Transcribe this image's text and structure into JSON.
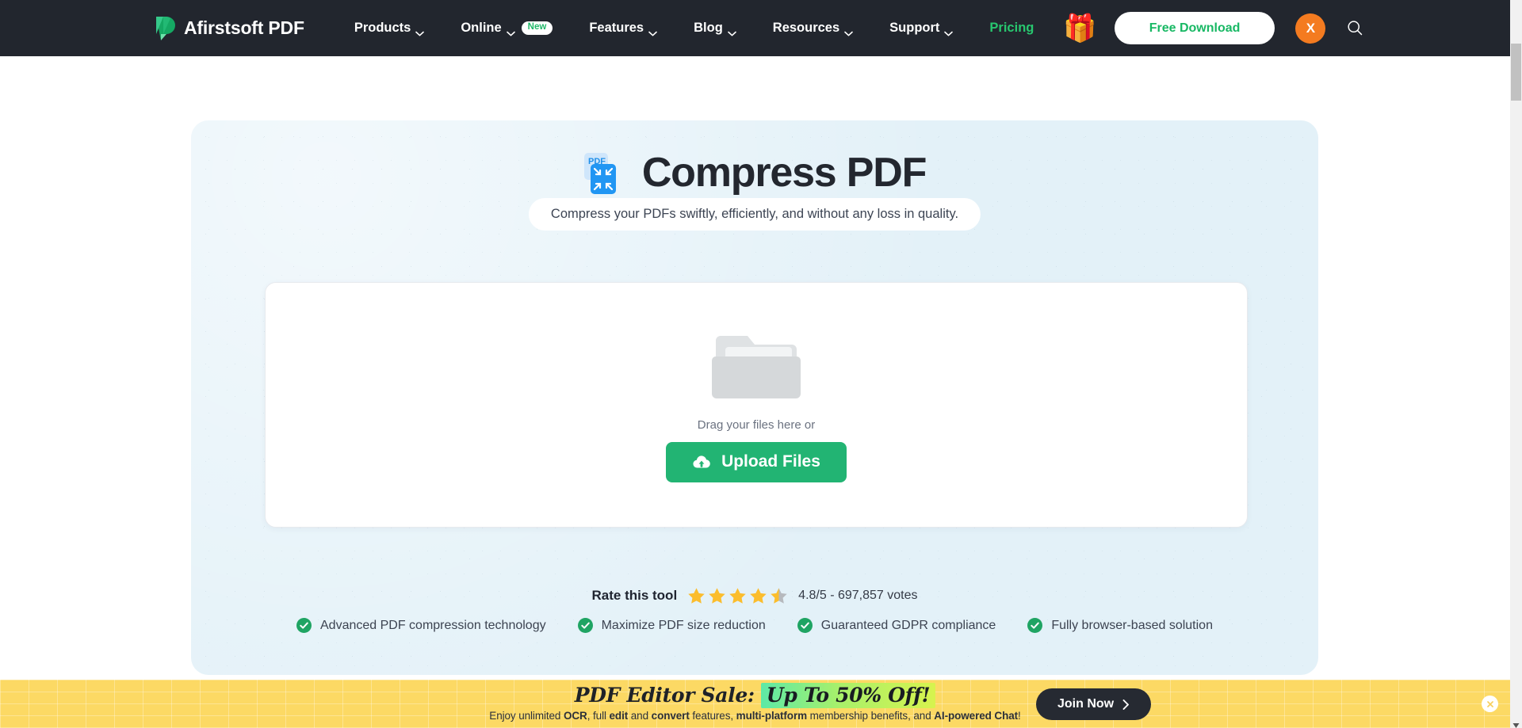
{
  "header": {
    "brand": "Afirstsoft PDF",
    "logo_icon": "afirstsoft-logo",
    "nav": [
      {
        "label": "Products",
        "has_caret": true,
        "badge": null,
        "accent": false
      },
      {
        "label": "Online",
        "has_caret": true,
        "badge": "New",
        "accent": false
      },
      {
        "label": "Features",
        "has_caret": true,
        "badge": null,
        "accent": false
      },
      {
        "label": "Blog",
        "has_caret": true,
        "badge": null,
        "accent": false
      },
      {
        "label": "Resources",
        "has_caret": true,
        "badge": null,
        "accent": false
      },
      {
        "label": "Support",
        "has_caret": true,
        "badge": null,
        "accent": false
      },
      {
        "label": "Pricing",
        "has_caret": false,
        "badge": null,
        "accent": true
      }
    ],
    "gift_icon": "gift-box-icon",
    "download_label": "Free Download",
    "avatar_initial": "X",
    "search_icon": "search-icon",
    "colors": {
      "bar": "#22262e",
      "accent_green": "#28c76f",
      "avatar": "#f47b20"
    }
  },
  "hero": {
    "title": "Compress PDF",
    "tool_icon": "compress-pdf-icon",
    "tool_icon_label": "PDF",
    "subtitle": "Compress your PDFs swiftly, efficiently, and without any loss in quality.",
    "background_color": "#e3f1f8"
  },
  "upload": {
    "folder_icon": "folder-icon",
    "drag_text": "Drag your files here or",
    "button_label": "Upload Files",
    "button_icon": "cloud-upload-icon",
    "button_color": "#22b473"
  },
  "rating": {
    "label": "Rate this tool",
    "stars_filled": 4,
    "stars_half": 1,
    "stars_total": 5,
    "score": "4.8/5",
    "summary": "4.8/5 - 697,857 votes",
    "star_color": "#fbbd2d"
  },
  "features": [
    {
      "icon": "check-circle-icon",
      "label": "Advanced PDF compression technology"
    },
    {
      "icon": "check-circle-icon",
      "label": "Maximize PDF size reduction"
    },
    {
      "icon": "check-circle-icon",
      "label": "Guaranteed GDPR compliance"
    },
    {
      "icon": "check-circle-icon",
      "label": "Fully browser-based solution"
    }
  ],
  "promo": {
    "headline_prefix": "PDF Editor Sale:",
    "headline_highlight": "Up To 50% Off!",
    "sub_parts": [
      {
        "text": "Enjoy unlimited ",
        "bold": false
      },
      {
        "text": "OCR",
        "bold": true
      },
      {
        "text": ", full ",
        "bold": false
      },
      {
        "text": "edit",
        "bold": true
      },
      {
        "text": " and ",
        "bold": false
      },
      {
        "text": "convert",
        "bold": true
      },
      {
        "text": " features, ",
        "bold": false
      },
      {
        "text": "multi-platform",
        "bold": true
      },
      {
        "text": " membership benefits, and ",
        "bold": false
      },
      {
        "text": "AI-powered Chat",
        "bold": true
      },
      {
        "text": "!",
        "bold": false
      }
    ],
    "cta_label": "Join Now",
    "cta_icon": "chevron-right-icon",
    "close_icon": "close-icon",
    "background_color": "#fcd964"
  },
  "scrollbar": {
    "thumb_position": "top",
    "arrow_icon": "scroll-down-arrow-icon"
  }
}
